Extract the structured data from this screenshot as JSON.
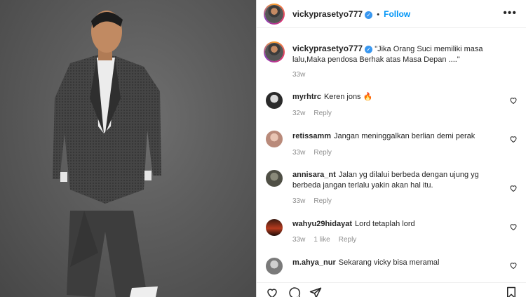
{
  "post": {
    "username": "vickyprasetyo777",
    "follow_label": "Follow",
    "more_label": "•••",
    "caption": "\"Jika Orang Suci memiliki masa lalu,Maka pendosa Berhak atas Masa Depan ....\"",
    "caption_time": "33w"
  },
  "comments": [
    {
      "username": "myrhtrc",
      "text": "Keren jons 🔥",
      "time": "32w",
      "likes": "",
      "reply": "Reply"
    },
    {
      "username": "retissamm",
      "text": "Jangan meninggalkan berlian demi perak",
      "time": "33w",
      "likes": "",
      "reply": "Reply"
    },
    {
      "username": "annisara_nt",
      "text": "Jalan yg dilalui berbeda dengan ujung yg berbeda jangan terlalu yakin akan hal itu.",
      "time": "33w",
      "likes": "",
      "reply": "Reply"
    },
    {
      "username": "wahyu29hidayat",
      "text": "Lord tetaplah lord",
      "time": "33w",
      "likes": "1 like",
      "reply": "Reply"
    },
    {
      "username": "m.ahya_nur",
      "text": "Sekarang vicky bisa meramal",
      "time": "",
      "likes": "",
      "reply": ""
    }
  ]
}
